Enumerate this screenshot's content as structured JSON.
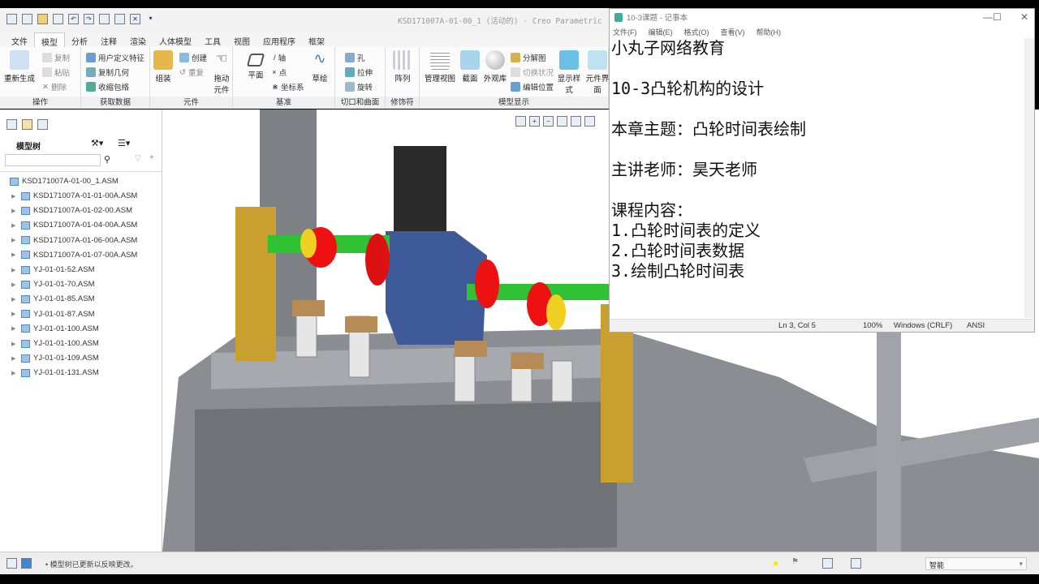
{
  "creo": {
    "title": "KSD171007A-01-00_1 (活动的) - Creo Parametric",
    "tabs": [
      "文件",
      "模型",
      "分析",
      "注释",
      "渲染",
      "人体模型",
      "工具",
      "视图",
      "应用程序",
      "框架"
    ],
    "ribbon": {
      "regen": "重新生成",
      "copy": "复制",
      "paste": "粘贴",
      "delete": "删除",
      "udf": "用户定义特征",
      "copy_geom": "复制几何",
      "shrinkwrap": "收缩包络",
      "assemble": "组装",
      "create": "创建",
      "repeat": "重复",
      "drag": "拖动元件",
      "plane": "平面",
      "axis": "轴",
      "point": "点",
      "csys": "坐标系",
      "sketch": "草绘",
      "hole": "孔",
      "extrude": "拉伸",
      "revolve": "旋转",
      "pattern": "阵列",
      "manage_views": "管理视图",
      "section": "截面",
      "appearance": "外观库",
      "exploded": "分解图",
      "toggle_state": "切换状况",
      "edit_position": "编辑位置",
      "display_style": "显示样式",
      "component_interface": "元件界面",
      "groups": [
        "操作",
        "获取数据",
        "元件",
        "基准",
        "切口和曲面",
        "修饰符",
        "模型显示"
      ]
    }
  },
  "tree": {
    "title": "模型树",
    "root": "KSD171007A-01-00_1.ASM",
    "items": [
      "KSD171007A-01-01-00A.ASM",
      "KSD171007A-01-02-00.ASM",
      "KSD171007A-01-04-00A.ASM",
      "KSD171007A-01-06-00A.ASM",
      "KSD171007A-01-07-00A.ASM",
      "YJ-01-01-52.ASM",
      "YJ-01-01-70.ASM",
      "YJ-01-01-85.ASM",
      "YJ-01-01-87.ASM",
      "YJ-01-01-100.ASM",
      "YJ-01-01-100.ASM",
      "YJ-01-01-109.ASM",
      "YJ-01-01-131.ASM"
    ]
  },
  "notepad": {
    "title": "10-3课题 - 记事本",
    "menu": [
      "文件(F)",
      "编辑(E)",
      "格式(O)",
      "查看(V)",
      "帮助(H)"
    ],
    "lines": [
      "小丸子网络教育",
      "",
      "10-3凸轮机构的设计",
      "",
      "本章主题：凸轮时间表绘制",
      "",
      "主讲老师：昊天老师",
      "",
      "课程内容：",
      "1.凸轮时间表的定义",
      "2.凸轮时间表数据",
      "3.绘制凸轮时间表"
    ],
    "status": {
      "pos": "Ln 3, Col 5",
      "zoom": "100%",
      "eol": "Windows (CRLF)",
      "enc": "ANSI"
    }
  },
  "statusbar": {
    "message": "• 模型树已更新以反映更改。",
    "filter": "智能"
  }
}
